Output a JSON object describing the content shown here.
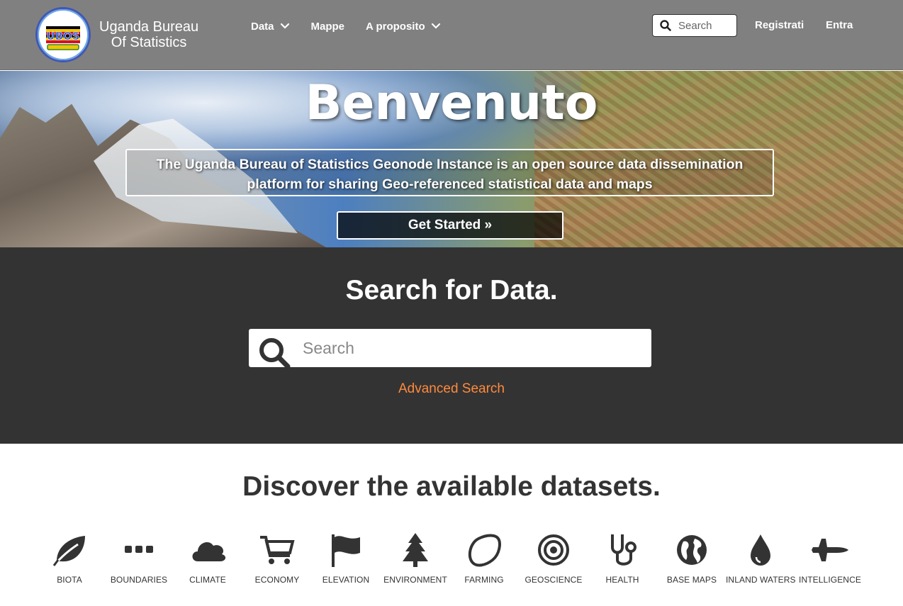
{
  "navbar": {
    "brand_line1": "Uganda Bureau",
    "brand_line2": "Of Statistics",
    "logo_text": "UBOS",
    "menu": [
      {
        "label": "Data",
        "has_dropdown": true
      },
      {
        "label": "Mappe",
        "has_dropdown": false
      },
      {
        "label": "A proposito",
        "has_dropdown": true
      }
    ],
    "search_placeholder": "Search",
    "register": "Registrati",
    "login": "Entra"
  },
  "hero": {
    "title": "Benvenuto",
    "description": "The Uganda Bureau of Statistics Geonode Instance is an open source data dissemination platform for sharing Geo-referenced statistical data and maps",
    "cta": "Get Started »"
  },
  "search_section": {
    "title": "Search for Data.",
    "placeholder": "Search",
    "advanced": "Advanced Search",
    "advanced_color": "#ff8a3d"
  },
  "discover": {
    "title": "Discover the available datasets.",
    "categories": [
      {
        "label": "BIOTA",
        "icon": "leaf-icon"
      },
      {
        "label": "BOUNDARIES",
        "icon": "ellipsis-icon"
      },
      {
        "label": "CLIMATE",
        "icon": "cloud-icon"
      },
      {
        "label": "ECONOMY",
        "icon": "cart-icon"
      },
      {
        "label": "ELEVATION",
        "icon": "flag-icon"
      },
      {
        "label": "ENVIRONMENT",
        "icon": "tree-icon"
      },
      {
        "label": "FARMING",
        "icon": "lemon-icon"
      },
      {
        "label": "GEOSCIENCE",
        "icon": "target-icon"
      },
      {
        "label": "HEALTH",
        "icon": "stethoscope-icon"
      },
      {
        "label": "BASE MAPS",
        "icon": "globe-icon"
      },
      {
        "label": "INLAND WATERS",
        "icon": "water-drop-icon"
      },
      {
        "label": "INTELLIGENCE",
        "icon": "fighter-jet-icon"
      }
    ]
  }
}
